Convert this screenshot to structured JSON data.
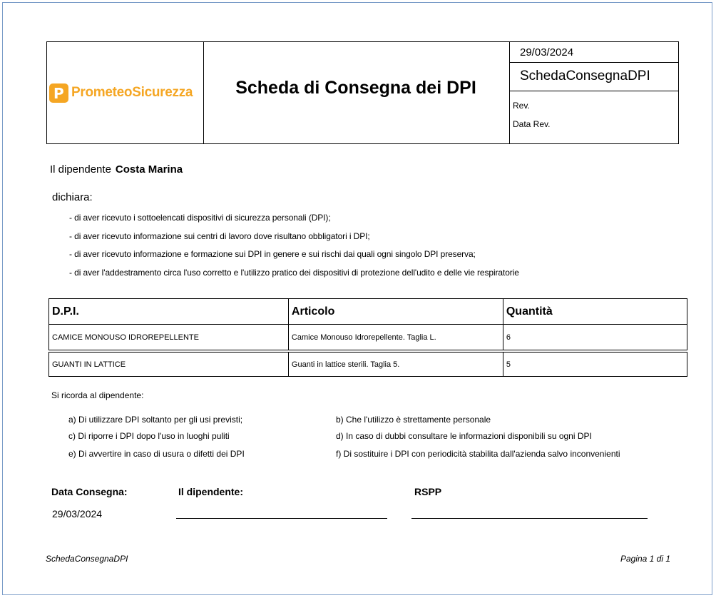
{
  "header": {
    "logo": {
      "part1": "Prometeo",
      "part2": "Sicurezza",
      "mark": "P"
    },
    "title": "Scheda di Consegna dei DPI",
    "date": "29/03/2024",
    "code": "SchedaConsegnaDPI",
    "rev_label": "Rev.",
    "data_rev_label": "Data Rev."
  },
  "employee": {
    "label": "Il dipendente",
    "name": "Costa Marina"
  },
  "declaration": {
    "intro": "dichiara:",
    "items": [
      "- di aver ricevuto i sottoelencati dispositivi di sicurezza personali (DPI);",
      "- di aver ricevuto informazione sui centri di lavoro dove risultano obbligatori i DPI;",
      "- di aver ricevuto informazione e formazione sui DPI in genere e sui rischi dai quali ogni singolo DPI preserva;",
      "- di aver l'addestramento circa l'uso corretto e l'utilizzo pratico dei dispositivi di protezione dell'udito e delle vie respiratorie"
    ]
  },
  "table": {
    "headers": [
      "D.P.I.",
      "Articolo",
      "Quantità"
    ],
    "rows": [
      [
        "CAMICE MONOUSO IDROREPELLENTE",
        "Camice Monouso Idrorepellente. Taglia L.",
        "6"
      ],
      [
        "GUANTI IN LATTICE",
        "Guanti in lattice sterili. Taglia 5.",
        "5"
      ]
    ]
  },
  "reminder": {
    "intro": "Si ricorda al dipendente:",
    "rules": [
      "a) Di utilizzare DPI soltanto per gli usi previsti;",
      "b) Che l'utilizzo è strettamente personale",
      "c) Di riporre i DPI dopo l'uso in luoghi puliti",
      "d) In caso di dubbi consultare le informazioni disponibili su ogni DPI",
      "e) Di avvertire in caso di usura o difetti dei DPI",
      "f) Di sostituire i DPI con periodicità stabilita dall'azienda salvo inconvenienti"
    ]
  },
  "signatures": {
    "date_label": "Data Consegna:",
    "date_value": "29/03/2024",
    "employee_label": "Il dipendente:",
    "rspp_label": "RSPP"
  },
  "footer": {
    "left": "SchedaConsegnaDPI",
    "right": "Pagina 1 di 1"
  }
}
